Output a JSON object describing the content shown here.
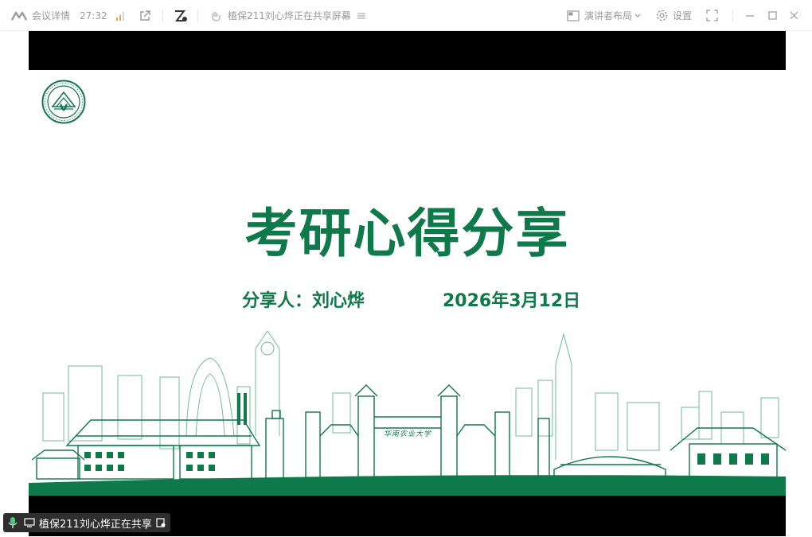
{
  "toolbar": {
    "meeting_details": "会议详情",
    "elapsed_time": "27:32",
    "sharer_status": "植保211刘心烨正在共享屏幕",
    "presenter_layout": "演讲者布局",
    "settings": "设置"
  },
  "slide": {
    "title": "考研心得分享",
    "presenter": "分享人：刘心烨",
    "date": "2026年3月12日",
    "gate_inscription": "华南农业大学"
  },
  "share_badge": {
    "text": "植保211刘心烨正在共享"
  },
  "colors": {
    "accent_green": "#0e7a4a",
    "toolbar_text": "#9a9a9a"
  }
}
